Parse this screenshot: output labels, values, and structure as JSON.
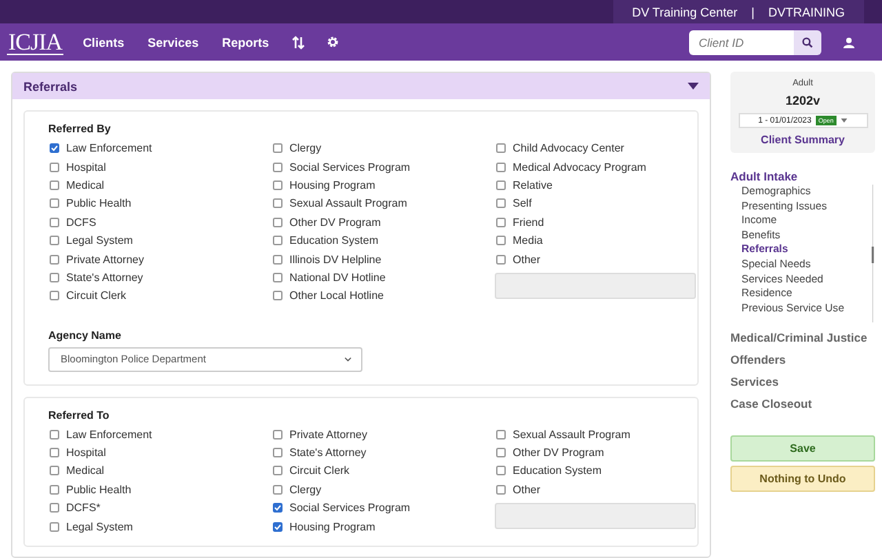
{
  "top_bar": {
    "organization": "DV Training Center",
    "separator": "|",
    "user": "DVTRAINING"
  },
  "nav": {
    "logo": "ICJIA",
    "items": [
      "Clients",
      "Services",
      "Reports"
    ],
    "search": {
      "placeholder": "Client ID"
    }
  },
  "panel": {
    "title": "Referrals",
    "expanded": true,
    "referred_by": {
      "title": "Referred By",
      "columns": [
        [
          {
            "label": "Law Enforcement",
            "checked": true
          },
          {
            "label": "Hospital",
            "checked": false
          },
          {
            "label": "Medical",
            "checked": false
          },
          {
            "label": "Public Health",
            "checked": false
          },
          {
            "label": "DCFS",
            "checked": false
          },
          {
            "label": "Legal System",
            "checked": false
          },
          {
            "label": "Private Attorney",
            "checked": false
          },
          {
            "label": "State's Attorney",
            "checked": false
          },
          {
            "label": "Circuit Clerk",
            "checked": false
          }
        ],
        [
          {
            "label": "Clergy",
            "checked": false
          },
          {
            "label": "Social Services Program",
            "checked": false
          },
          {
            "label": "Housing Program",
            "checked": false
          },
          {
            "label": "Sexual Assault Program",
            "checked": false
          },
          {
            "label": "Other DV Program",
            "checked": false
          },
          {
            "label": "Education System",
            "checked": false
          },
          {
            "label": "Illinois DV Helpline",
            "checked": false
          },
          {
            "label": "National DV Hotline",
            "checked": false
          },
          {
            "label": "Other Local Hotline",
            "checked": false
          }
        ],
        [
          {
            "label": "Child Advocacy Center",
            "checked": false
          },
          {
            "label": "Medical Advocacy Program",
            "checked": false
          },
          {
            "label": "Relative",
            "checked": false
          },
          {
            "label": "Self",
            "checked": false
          },
          {
            "label": "Friend",
            "checked": false
          },
          {
            "label": "Media",
            "checked": false
          },
          {
            "label": "Other",
            "checked": false
          }
        ]
      ],
      "other_field": {
        "disabled": true
      }
    },
    "agency": {
      "label": "Agency Name",
      "value": "Bloomington Police Department"
    },
    "referred_to": {
      "title": "Referred To",
      "columns": [
        [
          {
            "label": "Law Enforcement",
            "checked": false
          },
          {
            "label": "Hospital",
            "checked": false
          },
          {
            "label": "Medical",
            "checked": false
          },
          {
            "label": "Public Health",
            "checked": false
          },
          {
            "label": "DCFS*",
            "checked": false
          },
          {
            "label": "Legal System",
            "checked": false
          }
        ],
        [
          {
            "label": "Private Attorney",
            "checked": false
          },
          {
            "label": "State's Attorney",
            "checked": false
          },
          {
            "label": "Circuit Clerk",
            "checked": false
          },
          {
            "label": "Clergy",
            "checked": false
          },
          {
            "label": "Social Services Program",
            "checked": true
          },
          {
            "label": "Housing Program",
            "checked": true
          }
        ],
        [
          {
            "label": "Sexual Assault Program",
            "checked": false
          },
          {
            "label": "Other DV Program",
            "checked": false
          },
          {
            "label": "Education System",
            "checked": false
          },
          {
            "label": "Other",
            "checked": false
          }
        ]
      ],
      "other_field": {
        "disabled": true
      }
    }
  },
  "sidebar": {
    "client_type": "Adult",
    "client_id": "1202v",
    "case": {
      "label": "1 - 01/01/2023",
      "status": "Open"
    },
    "summary_link": "Client Summary",
    "sections": [
      {
        "label": "Adult Intake",
        "expanded": true,
        "children": [
          {
            "label": "Demographics",
            "selected": false
          },
          {
            "label": "Presenting Issues",
            "selected": false
          },
          {
            "label": "Income",
            "selected": false
          },
          {
            "label": "Benefits",
            "selected": false
          },
          {
            "label": "Referrals",
            "selected": true
          },
          {
            "label": "Special Needs",
            "selected": false
          },
          {
            "label": "Services Needed",
            "selected": false
          },
          {
            "label": "Residence",
            "selected": false
          },
          {
            "label": "Previous Service Use",
            "selected": false
          }
        ]
      },
      {
        "label": "Medical/Criminal Justice",
        "expanded": false
      },
      {
        "label": "Offenders",
        "expanded": false
      },
      {
        "label": "Services",
        "expanded": false
      },
      {
        "label": "Case Closeout",
        "expanded": false
      }
    ],
    "buttons": [
      {
        "kind": "save",
        "label": "Save"
      },
      {
        "kind": "undo",
        "label": "Nothing to Undo"
      }
    ]
  }
}
